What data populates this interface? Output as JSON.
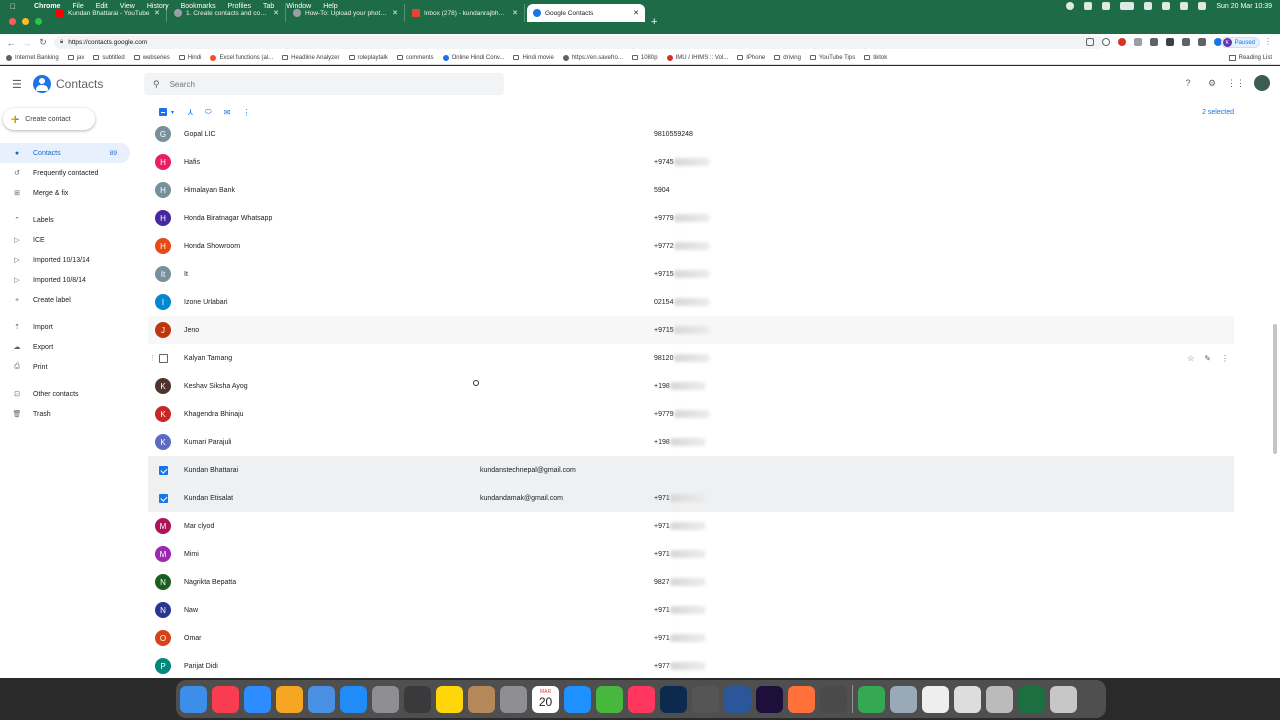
{
  "menubar": {
    "app": "Chrome",
    "items": [
      "File",
      "Edit",
      "View",
      "History",
      "Bookmarks",
      "Profiles",
      "Tab",
      "Window",
      "Help"
    ],
    "clock": "Sun 20 Mar  10:39"
  },
  "tabs": [
    {
      "label": "Kundan Bhattarai - YouTube",
      "favicon_color": "#ff0000"
    },
    {
      "label": "1. Create contacts and contact...",
      "favicon_color": "#9aa0a6"
    },
    {
      "label": "How-To: Upload your photos in...",
      "favicon_color": "#9aa0a6"
    },
    {
      "label": "Inbox (278) - kundanrajbhattar...",
      "favicon_color": "#ea4335"
    },
    {
      "label": "Google Contacts",
      "favicon_color": "#1a73e8",
      "active": true
    }
  ],
  "toolbar": {
    "url": "https://contacts.google.com",
    "profile_status": "Paused",
    "profile_initial": "K"
  },
  "bookmarks": [
    {
      "label": "Internet Banking",
      "icon": "globe"
    },
    {
      "label": "jav",
      "icon": "folder"
    },
    {
      "label": "subtitled",
      "icon": "folder"
    },
    {
      "label": "webseries",
      "icon": "folder"
    },
    {
      "label": "Hindi",
      "icon": "folder"
    },
    {
      "label": "Excel functions (al...",
      "icon": "windows"
    },
    {
      "label": "Headline Analyzer",
      "icon": "folder"
    },
    {
      "label": "roleplaytalk",
      "icon": "folder"
    },
    {
      "label": "comments",
      "icon": "folder"
    },
    {
      "label": "Online Hindi Conv...",
      "icon": "shield"
    },
    {
      "label": "Hindi movie",
      "icon": "folder"
    },
    {
      "label": "https://en.savefro...",
      "icon": "globe"
    },
    {
      "label": "1080p",
      "icon": "folder"
    },
    {
      "label": "IMU / IHIMS :: Vol...",
      "icon": "red"
    },
    {
      "label": "IPhone",
      "icon": "folder"
    },
    {
      "label": "driving",
      "icon": "folder"
    },
    {
      "label": "YouTube Tips",
      "icon": "folder"
    },
    {
      "label": "tiktok",
      "icon": "folder"
    }
  ],
  "reading_list": "Reading List",
  "app": {
    "title": "Contacts",
    "search_placeholder": "Search",
    "create_contact": "Create contact",
    "selected_count": "2 selected"
  },
  "sidebar": {
    "items": [
      {
        "label": "Contacts",
        "count": "89",
        "active": true,
        "icon": "person"
      },
      {
        "label": "Frequently contacted",
        "icon": "history"
      },
      {
        "label": "Merge & fix",
        "icon": "merge"
      }
    ],
    "labels_header": "Labels",
    "labels": [
      "ICE",
      "Imported 10/13/14",
      "Imported 10/8/14"
    ],
    "create_label": "Create label",
    "actions": [
      "Import",
      "Export",
      "Print"
    ],
    "other": [
      "Other contacts",
      "Trash"
    ]
  },
  "contacts": [
    {
      "initial": "G",
      "color": "#78909c",
      "name": "Gopal LIC",
      "email": "",
      "phone": "9810559248"
    },
    {
      "initial": "H",
      "color": "#e91e63",
      "name": "Hafis",
      "email": "",
      "phone": "+9745",
      "blurred": true
    },
    {
      "initial": "H",
      "color": "#78909c",
      "name": "Himalayan Bank",
      "email": "",
      "phone": "5904"
    },
    {
      "initial": "H",
      "color": "#4527a0",
      "name": "Honda Biratnagar Whatsapp",
      "email": "",
      "phone": "+9779",
      "blurred": true
    },
    {
      "initial": "H",
      "color": "#e64a19",
      "name": "Honda Showroom",
      "email": "",
      "phone": "+9772",
      "blurred": true
    },
    {
      "initial": "It",
      "color": "#78909c",
      "name": "It",
      "email": "",
      "phone": "+9715",
      "blurred": true
    },
    {
      "initial": "I",
      "color": "#0288d1",
      "name": "Izone Urlabari",
      "email": "",
      "phone": "02154",
      "blurred": true
    },
    {
      "initial": "J",
      "color": "#bf360c",
      "name": "Jeno",
      "email": "",
      "phone": "+9715",
      "blurred": true,
      "tint": true
    },
    {
      "initial": "",
      "color": "",
      "name": "Kalyan Tamang",
      "email": "",
      "phone": "98120",
      "blurred": true,
      "hover": true
    },
    {
      "initial": "K",
      "color": "#4e342e",
      "name": "Keshav Siksha Ayog",
      "email": "",
      "phone": "+198",
      "blurred": true
    },
    {
      "initial": "K",
      "color": "#c62828",
      "name": "Khagendra Bhinaju",
      "email": "",
      "phone": "+9779",
      "blurred": true
    },
    {
      "initial": "K",
      "color": "#5c6bc0",
      "name": "Kumari Parajuli",
      "email": "",
      "phone": "+198",
      "blurred": true
    },
    {
      "initial": "",
      "color": "",
      "name": "Kundan Bhattarai",
      "email": "kundanstechnepal@gmail.com",
      "phone": "",
      "selected": true
    },
    {
      "initial": "",
      "color": "",
      "name": "Kundan Etisalat",
      "email": "kundandamak@gmail.com",
      "phone": "+971",
      "blurred": true,
      "selected": true
    },
    {
      "initial": "M",
      "color": "#ad1457",
      "name": "Mar clyod",
      "email": "",
      "phone": "+971",
      "blurred": true
    },
    {
      "initial": "M",
      "color": "#9c27b0",
      "name": "Mimi",
      "email": "",
      "phone": "+971",
      "blurred": true
    },
    {
      "initial": "N",
      "color": "#1b5e20",
      "name": "Nagrikta Bepatta",
      "email": "",
      "phone": "9827",
      "blurred": true
    },
    {
      "initial": "N",
      "color": "#283593",
      "name": "Naw",
      "email": "",
      "phone": "+971",
      "blurred": true
    },
    {
      "initial": "O",
      "color": "#d84315",
      "name": "Omar",
      "email": "",
      "phone": "+971",
      "blurred": true
    },
    {
      "initial": "P",
      "color": "#00897b",
      "name": "Parijat Didi",
      "email": "",
      "phone": "+977",
      "blurred": true
    }
  ],
  "dock": {
    "calendar_month": "MAR",
    "calendar_day": "20",
    "apps": [
      {
        "name": "finder",
        "color": "#3d8ee8"
      },
      {
        "name": "music",
        "color": "#fa3c50"
      },
      {
        "name": "zoom",
        "color": "#2d8cff"
      },
      {
        "name": "photos",
        "color": "#f5a623"
      },
      {
        "name": "mail",
        "color": "#4a90e2"
      },
      {
        "name": "app-store",
        "color": "#1f8cf7"
      },
      {
        "name": "launchpad",
        "color": "#8e8e93"
      },
      {
        "name": "calculator",
        "color": "#3a3a3c"
      },
      {
        "name": "notes",
        "color": "#ffd60a"
      },
      {
        "name": "contacts-app",
        "color": "#b5885a"
      },
      {
        "name": "system-preferences",
        "color": "#8e8e93"
      },
      {
        "name": "calendar",
        "color": "#ffffff"
      },
      {
        "name": "safari",
        "color": "#1e90ff"
      },
      {
        "name": "utorrent",
        "color": "#47b83d"
      },
      {
        "name": "news",
        "color": "#ff375f"
      },
      {
        "name": "photoshop",
        "color": "#0c2a4d"
      },
      {
        "name": "vpn",
        "color": "#555555"
      },
      {
        "name": "word",
        "color": "#2b579a"
      },
      {
        "name": "premiere",
        "color": "#1d0f3a"
      },
      {
        "name": "firefox",
        "color": "#ff7139"
      },
      {
        "name": "quicktime",
        "color": "#4a4a4a"
      },
      {
        "name": "chrome",
        "color": "#34a853"
      },
      {
        "name": "preview",
        "color": "#9aa9b8"
      },
      {
        "name": "textedit",
        "color": "#eeeeee"
      },
      {
        "name": "iphone-backup",
        "color": "#dddddd"
      },
      {
        "name": "help",
        "color": "#bbbbbb"
      },
      {
        "name": "excel",
        "color": "#1d6f42"
      },
      {
        "name": "trash",
        "color": "#c7c7c7"
      }
    ]
  }
}
